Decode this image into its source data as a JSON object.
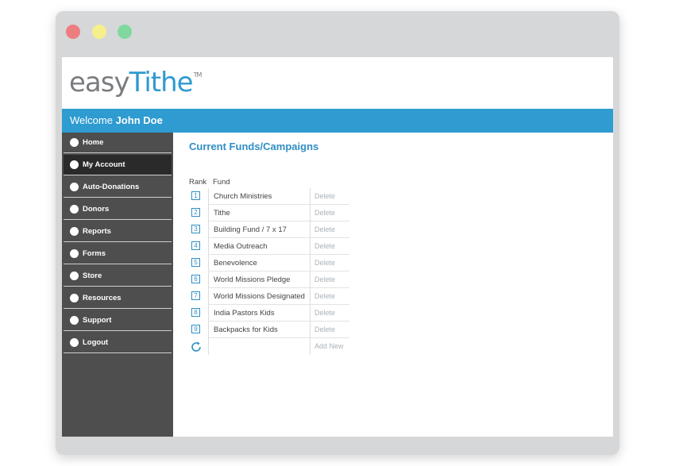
{
  "app": {
    "logo_part1": "easy",
    "logo_part2": "Tithe",
    "logo_tm": "TM",
    "brand_color": "#2e9bd1"
  },
  "header": {
    "welcome_prefix": "Welcome",
    "user_name": "John Doe"
  },
  "sidebar": {
    "items": [
      {
        "label": "Home"
      },
      {
        "label": "My Account",
        "active": true
      },
      {
        "label": "Auto-Donations"
      },
      {
        "label": "Donors"
      },
      {
        "label": "Reports"
      },
      {
        "label": "Forms"
      },
      {
        "label": "Store"
      },
      {
        "label": "Resources"
      },
      {
        "label": "Support"
      },
      {
        "label": "Logout"
      }
    ]
  },
  "main": {
    "title": "Current Funds/Campaigns",
    "columns": {
      "rank": "Rank",
      "fund": "Fund"
    },
    "funds": [
      {
        "rank": "1",
        "name": "Church Ministries",
        "action": "Delete"
      },
      {
        "rank": "2",
        "name": "Tithe",
        "action": "Delete"
      },
      {
        "rank": "3",
        "name": "Building Fund / 7 x 17",
        "action": "Delete"
      },
      {
        "rank": "4",
        "name": "Media Outreach",
        "action": "Delete"
      },
      {
        "rank": "5",
        "name": "Benevolence",
        "action": "Delete"
      },
      {
        "rank": "6",
        "name": "World Missions Pledge",
        "action": "Delete"
      },
      {
        "rank": "7",
        "name": "World Missions Designated",
        "action": "Delete"
      },
      {
        "rank": "8",
        "name": "India Pastors Kids",
        "action": "Delete"
      },
      {
        "rank": "9",
        "name": "Backpacks for Kids",
        "action": "Delete"
      }
    ],
    "add_label": "Add New",
    "icons": {
      "add_row": "refresh-icon",
      "nav_bullet": "circle-icon"
    }
  }
}
